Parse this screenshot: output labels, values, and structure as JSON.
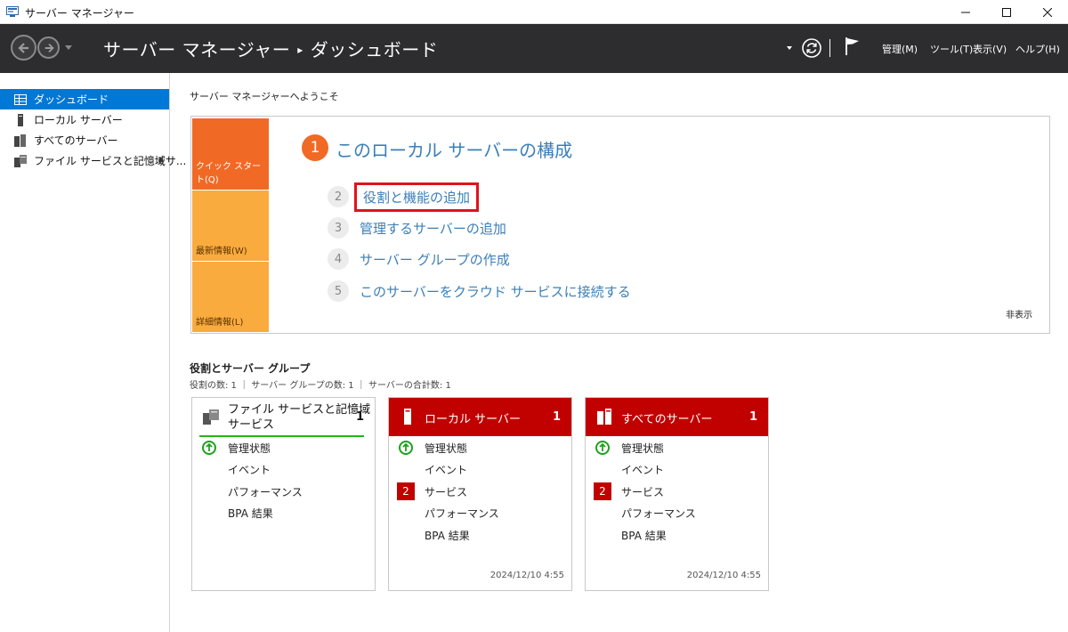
{
  "window": {
    "title": "サーバー マネージャー"
  },
  "header": {
    "breadcrumb_app": "サーバー マネージャー",
    "breadcrumb_separator": "▸",
    "breadcrumb_page": "ダッシュボード",
    "menus": [
      "管理(M)",
      "ツール(T)",
      "表示(V)",
      "ヘルプ(H)"
    ],
    "icons": [
      "back-arrow-icon",
      "forward-arrow-icon",
      "refresh-icon",
      "flag-icon"
    ]
  },
  "sidebar": {
    "items": [
      {
        "label": "ダッシュボード",
        "active": true,
        "icon": "dashboard-grid-icon"
      },
      {
        "label": "ローカル サーバー",
        "active": false,
        "icon": "server-icon"
      },
      {
        "label": "すべてのサーバー",
        "active": false,
        "icon": "servers-icon"
      },
      {
        "label": "ファイル サービスと記憶域サ...",
        "active": false,
        "icon": "file-services-icon"
      }
    ]
  },
  "main": {
    "welcome_title": "サーバー マネージャーへようこそ",
    "quick_start": {
      "tabs": [
        "クイック スタート(Q)",
        "最新情報(W)",
        "詳細情報(L)"
      ],
      "step1_number": "1",
      "step1_text": "このローカル サーバーの構成",
      "steps": [
        {
          "num": "2",
          "text": "役割と機能の追加",
          "highlighted": true
        },
        {
          "num": "3",
          "text": "管理するサーバーの追加"
        },
        {
          "num": "4",
          "text": "サーバー グループの作成"
        },
        {
          "num": "5",
          "text": "このサーバーをクラウド サービスに接続する"
        }
      ],
      "hide_label": "非表示"
    },
    "roles": {
      "title": "役割とサーバー グループ",
      "count_text": "役割の数: 1 ｜ サーバー グループの数: 1 ｜ サーバーの合計数: 1"
    },
    "cards": [
      {
        "title_line1": "ファイル サービスと記憶域",
        "title_line2": "サービス",
        "count": "1",
        "rows": [
          "管理状態",
          "イベント",
          "パフォーマンス",
          "BPA 結果"
        ],
        "status_color": "#1ea11e"
      },
      {
        "title": "ローカル サーバー",
        "count": "1",
        "rows": [
          "管理状態",
          "イベント",
          "サービス",
          "パフォーマンス",
          "BPA 結果"
        ],
        "service_badge": "2",
        "timestamp": "2024/12/10 4:55",
        "header_color": "#c10000"
      },
      {
        "title": "すべてのサーバー",
        "count": "1",
        "rows": [
          "管理状態",
          "イベント",
          "サービス",
          "パフォーマンス",
          "BPA 結果"
        ],
        "service_badge": "2",
        "timestamp": "2024/12/10 4:55",
        "header_color": "#c10000"
      }
    ]
  },
  "colors": {
    "accent_blue": "#0078d7",
    "link_blue": "#3b7fb8",
    "quick_start_orange": "#f06a25",
    "tab_amber": "#f9ab3e",
    "alert_red": "#c10000",
    "highlight_red": "#e0121b",
    "ok_green": "#1ea11e",
    "header_dark": "#2d2d30"
  }
}
